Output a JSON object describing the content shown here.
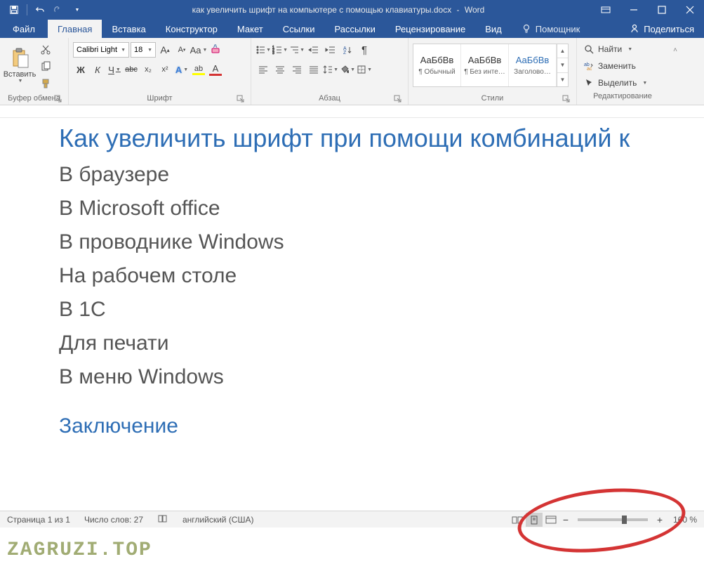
{
  "titlebar": {
    "doc_name": "как увеличить шрифт на компьютере с помощью клавиатуры.docx",
    "separator": "-",
    "app_name": "Word"
  },
  "tabs": {
    "file": "Файл",
    "home": "Главная",
    "insert": "Вставка",
    "design": "Конструктор",
    "layout": "Макет",
    "references": "Ссылки",
    "mailings": "Рассылки",
    "review": "Рецензирование",
    "view": "Вид",
    "tell_me": "Помощник",
    "share": "Поделиться"
  },
  "ribbon": {
    "clipboard": {
      "label": "Буфер обмена",
      "paste": "Вставить"
    },
    "font": {
      "label": "Шрифт",
      "name": "Calibri Light",
      "size": "18",
      "bold": "Ж",
      "italic": "К",
      "underline": "Ч",
      "strike": "abc",
      "sub": "x₂",
      "sup": "x²"
    },
    "paragraph": {
      "label": "Абзац"
    },
    "styles": {
      "label": "Стили",
      "preview": "АаБбВв",
      "s1": "¶ Обычный",
      "s2": "¶ Без инте…",
      "s3": "Заголово…"
    },
    "editing": {
      "label": "Редактирование",
      "find": "Найти",
      "replace": "Заменить",
      "select": "Выделить"
    }
  },
  "document": {
    "title": "Как увеличить шрифт при помощи комбинаций к",
    "p1": "В браузере",
    "p2": "В Microsoft office",
    "p3": "В проводнике Windows",
    "p4": "На рабочем столе",
    "p5": "В 1С",
    "p6": "Для печати",
    "p7": "В меню Windows",
    "conclusion": "Заключение"
  },
  "statusbar": {
    "page": "Страница 1 из 1",
    "words": "Число слов: 27",
    "lang": "английский (США)",
    "zoom": "160 %"
  },
  "watermark": "ZAGRUZI.TOP"
}
